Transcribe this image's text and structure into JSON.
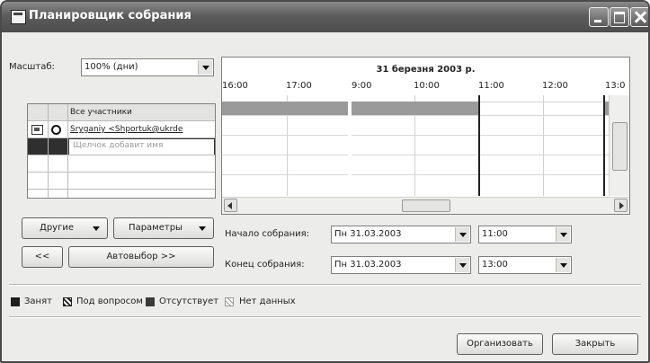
{
  "window": {
    "title": "Планировщик собрания"
  },
  "zoom": {
    "label": "Масштаб:",
    "value": "100% (дни)"
  },
  "attendees": {
    "header": "Все участники",
    "rows": [
      {
        "name": "Sryganiy <Shportuk@ukrde"
      },
      {
        "hint": "Щелчок добавит имя"
      }
    ]
  },
  "schedule": {
    "date": "31 березня 2003 р.",
    "hours": [
      "16:00",
      "17:00",
      "9:00",
      "10:00",
      "11:00",
      "12:00",
      "13:0"
    ]
  },
  "buttons": {
    "others": "Другие",
    "options": "Параметры",
    "prev": "<<",
    "autopick": "Автовыбор >>",
    "organize": "Организовать",
    "close": "Закрыть"
  },
  "meeting": {
    "start_label": "Начало собрания:",
    "start_date": "Пн 31.03.2003",
    "start_time": "11:00",
    "end_label": "Конец собрания:",
    "end_date": "Пн 31.03.2003",
    "end_time": "13:00"
  },
  "legend": {
    "busy": "Занят",
    "tentative": "Под вопросом",
    "away": "Отсутствует",
    "nodata": "Нет данных"
  }
}
